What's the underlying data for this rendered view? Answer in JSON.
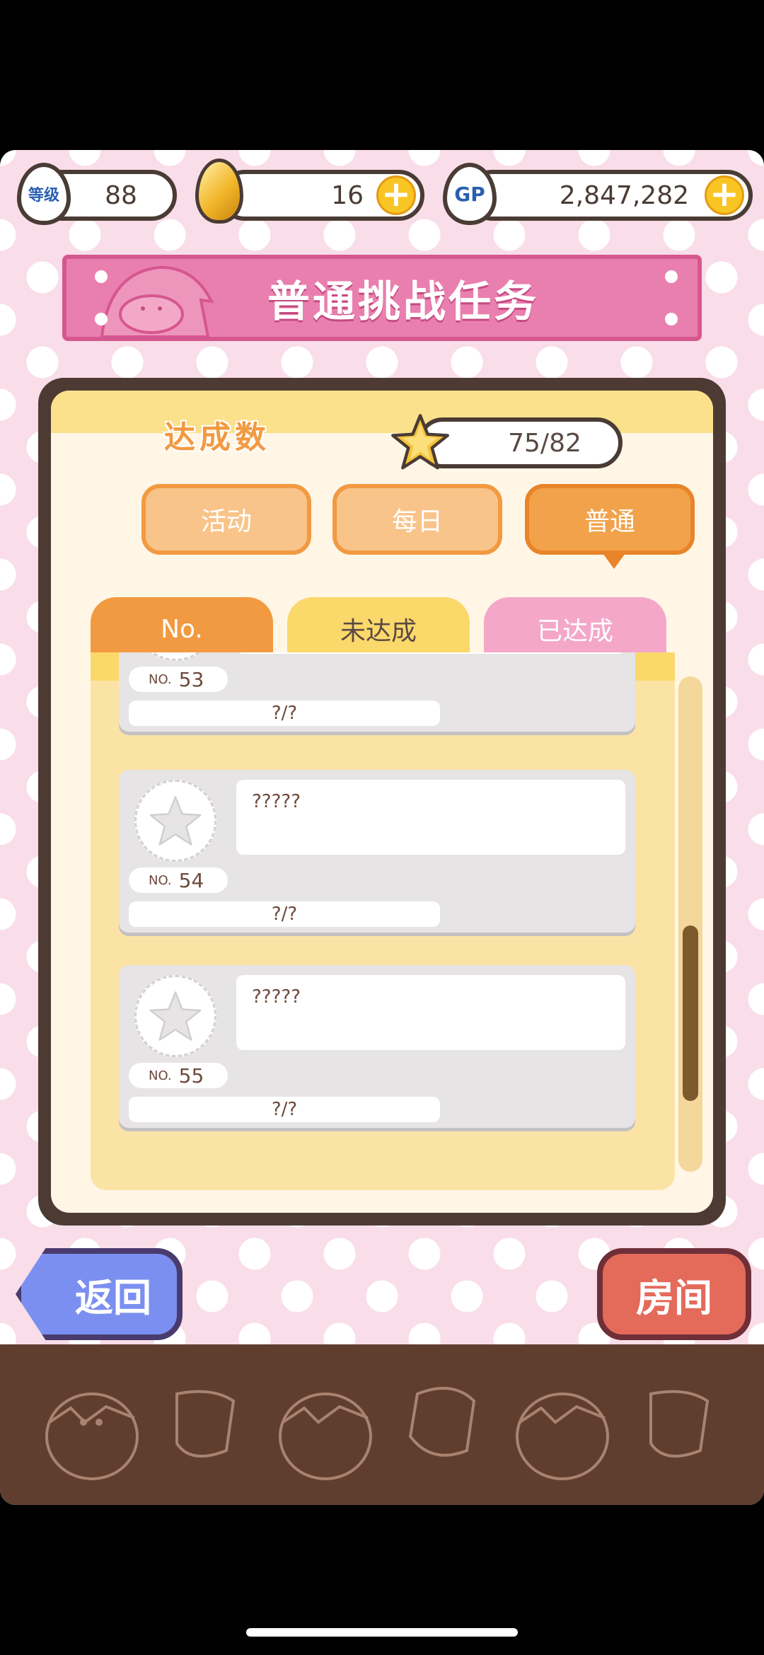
{
  "topbar": {
    "level_label": "等级",
    "level_value": "88",
    "eggs_value": "16",
    "gp_label": "GP",
    "gp_value": "2,847,282",
    "plus_symbol": "+"
  },
  "banner": {
    "title": "普通挑战任务"
  },
  "progress": {
    "label": "达成数",
    "value": "75/82"
  },
  "filters": [
    {
      "label": "活动",
      "active": false
    },
    {
      "label": "每日",
      "active": false
    },
    {
      "label": "普通",
      "active": true
    }
  ],
  "tabs": [
    {
      "label": "No."
    },
    {
      "label": "未达成"
    },
    {
      "label": "已达成"
    }
  ],
  "missions": [
    {
      "no_prefix": "NO.",
      "number": "53",
      "title": "",
      "progress": "?/?"
    },
    {
      "no_prefix": "NO.",
      "number": "54",
      "title": "?????",
      "progress": "?/?"
    },
    {
      "no_prefix": "NO.",
      "number": "55",
      "title": "?????",
      "progress": "?/?"
    }
  ],
  "buttons": {
    "back": "返回",
    "room": "房间"
  },
  "colors": {
    "accent_orange": "#f29a41",
    "tab_pink": "#f4a7c9",
    "banner_pink": "#e97fae",
    "back_blue": "#7b8ff0",
    "room_red": "#e46a5a",
    "panel_brown": "#4d3b33"
  }
}
